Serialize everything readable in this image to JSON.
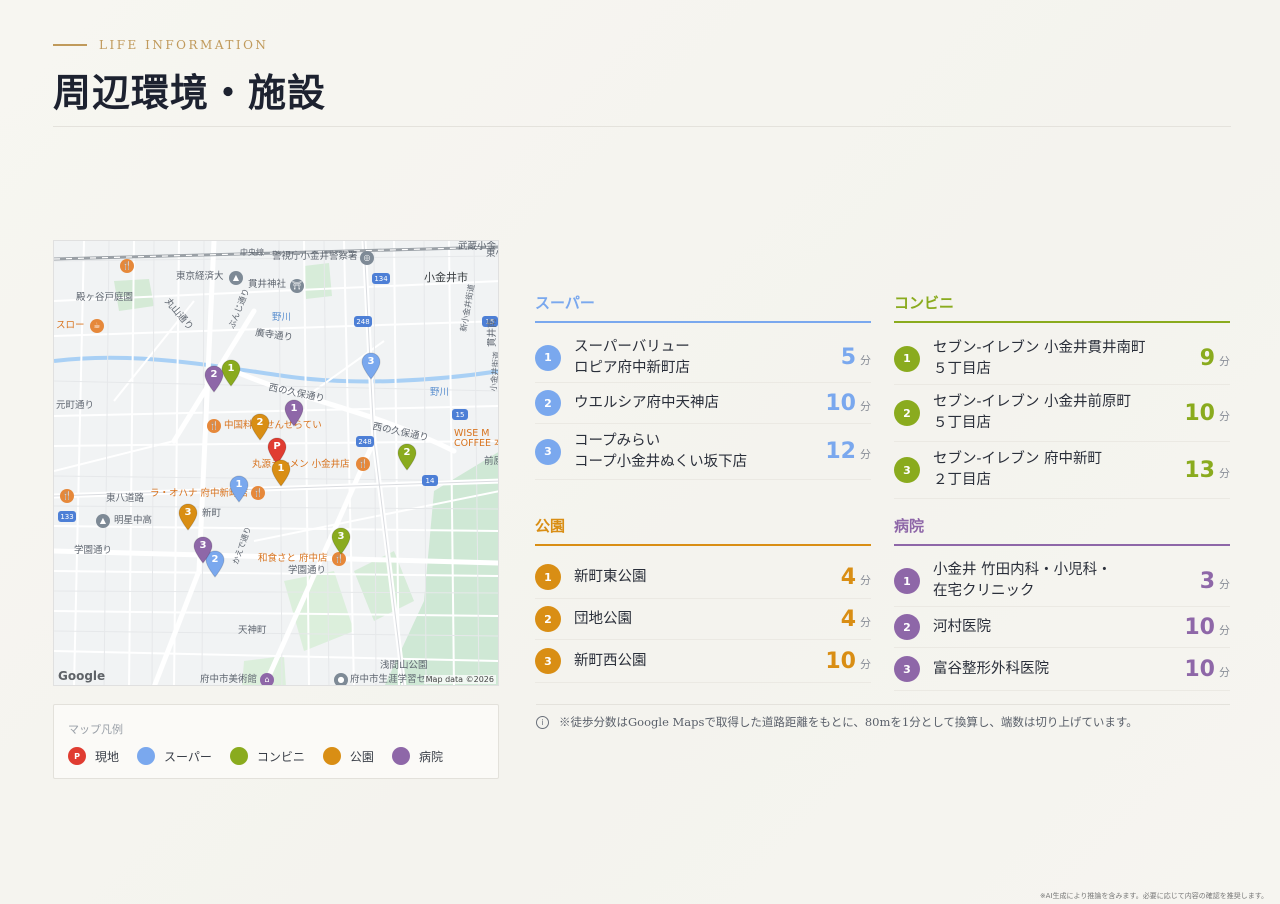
{
  "header": {
    "eyebrow": "LIFE INFORMATION",
    "title": "周辺環境・施設"
  },
  "colors": {
    "site": "#e03c31",
    "super": "#7aa8ee",
    "conbini": "#8aab1e",
    "park": "#d98e14",
    "hospital": "#8e67a8",
    "accent": "#c09a5b"
  },
  "map": {
    "attribution": "Map data ©2026",
    "logo": "Google",
    "labels": {
      "l1": "警視庁小金井警察署",
      "l2": "中央線",
      "l3": "武蔵小金",
      "l4": "東京経済大",
      "l5": "貫井神社",
      "l6": "小金井市",
      "l7": "殿ヶ谷戸庭園",
      "l8": "丸山通り",
      "l9": "スロー",
      "l10": "野川",
      "l11": "ぶんじ通り",
      "l12": "廣寺通り",
      "l13": "西の久保通り",
      "l14": "元町通り",
      "l15": "中国料理 せんせらてい",
      "l16": "西の久保通り",
      "l17": "WISE M\nCOFFEE 本",
      "l18": "丸源ラーメン 小金井店",
      "l19": "ラ・オハナ 府中新町店",
      "l20": "東八道路",
      "l21": "明星中高",
      "l22": "新町",
      "l23": "学園通り",
      "l24": "和食さと 府中店",
      "l25": "学園通り",
      "l26": "天神町",
      "l27": "浅間山公園",
      "l28": "府中市美術館",
      "l29": "府中市生涯学習セン",
      "l30": "前原",
      "l31": "貫井南",
      "l32": "野川",
      "l33": "新小金井街道",
      "l34": "小金井街道",
      "l35": "かえで通り",
      "l36": "東小"
    },
    "pins": [
      {
        "key": "site",
        "label": "P"
      },
      {
        "key": "super1",
        "label": "1"
      },
      {
        "key": "super2",
        "label": "2"
      },
      {
        "key": "super3",
        "label": "3"
      },
      {
        "key": "conbini1",
        "label": "1"
      },
      {
        "key": "conbini2",
        "label": "2"
      },
      {
        "key": "conbini3",
        "label": "3"
      },
      {
        "key": "park1",
        "label": "1"
      },
      {
        "key": "park2",
        "label": "2"
      },
      {
        "key": "park3",
        "label": "3"
      },
      {
        "key": "hosp1",
        "label": "1"
      },
      {
        "key": "hosp2",
        "label": "2"
      },
      {
        "key": "hosp3",
        "label": "3"
      }
    ],
    "route_numbers": [
      "134",
      "248",
      "248",
      "15",
      "14",
      "133",
      "15"
    ]
  },
  "legend": {
    "title": "マップ凡例",
    "items": [
      {
        "label": "現地",
        "mark": "P"
      },
      {
        "label": "スーパー"
      },
      {
        "label": "コンビニ"
      },
      {
        "label": "公園"
      },
      {
        "label": "病院"
      }
    ]
  },
  "categories": {
    "super": {
      "title": "スーパー",
      "items": [
        {
          "num": "1",
          "name": "スーパーバリュー\nロピア府中新町店",
          "min": "5",
          "unit": "分"
        },
        {
          "num": "2",
          "name": "ウエルシア府中天神店",
          "min": "10",
          "unit": "分"
        },
        {
          "num": "3",
          "name": "コープみらい\nコープ小金井ぬくい坂下店",
          "min": "12",
          "unit": "分"
        }
      ]
    },
    "conbini": {
      "title": "コンビニ",
      "items": [
        {
          "num": "1",
          "name": "セブン-イレブン 小金井貫井南町\n５丁目店",
          "min": "9",
          "unit": "分"
        },
        {
          "num": "2",
          "name": "セブン-イレブン 小金井前原町\n５丁目店",
          "min": "10",
          "unit": "分"
        },
        {
          "num": "3",
          "name": "セブン-イレブン 府中新町\n２丁目店",
          "min": "13",
          "unit": "分"
        }
      ]
    },
    "park": {
      "title": "公園",
      "items": [
        {
          "num": "1",
          "name": "新町東公園",
          "min": "4",
          "unit": "分"
        },
        {
          "num": "2",
          "name": "団地公園",
          "min": "4",
          "unit": "分"
        },
        {
          "num": "3",
          "name": "新町西公園",
          "min": "10",
          "unit": "分"
        }
      ]
    },
    "hospital": {
      "title": "病院",
      "items": [
        {
          "num": "1",
          "name": "小金井 竹田内科・小児科・\n在宅クリニック",
          "min": "3",
          "unit": "分"
        },
        {
          "num": "2",
          "name": "河村医院",
          "min": "10",
          "unit": "分"
        },
        {
          "num": "3",
          "name": "富谷整形外科医院",
          "min": "10",
          "unit": "分"
        }
      ]
    }
  },
  "note": {
    "icon": "i",
    "text": "※徒歩分数はGoogle Mapsで取得した道路距離をもとに、80mを1分として換算し、端数は切り上げています。"
  },
  "footer": {
    "disclaimer": "※AI生成により推論を含みます。必要に応じて内容の確認を推奨します。"
  }
}
